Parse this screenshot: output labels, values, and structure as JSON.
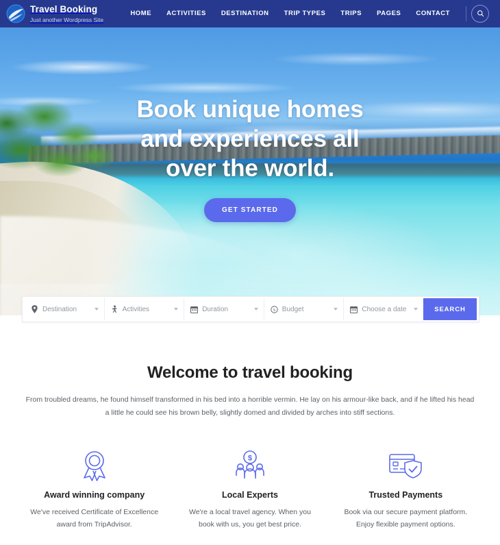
{
  "header": {
    "brand": {
      "title": "Travel Booking",
      "tagline": "Just another Wordpress Site",
      "logo_icon": "swoosh-circle-logo-icon"
    },
    "nav": [
      {
        "label": "HOME"
      },
      {
        "label": "ACTIVITIES"
      },
      {
        "label": "DESTINATION"
      },
      {
        "label": "TRIP TYPES"
      },
      {
        "label": "TRIPS"
      },
      {
        "label": "PAGES"
      },
      {
        "label": "CONTACT"
      }
    ],
    "search_icon": "search-icon",
    "colors": {
      "background": "#25398e",
      "text": "#ffffff"
    }
  },
  "hero": {
    "title": "Book unique homes and experiences all over the world.",
    "cta_label": "GET STARTED",
    "cta_color": "#5b6aec"
  },
  "search_bar": {
    "fields": [
      {
        "placeholder": "Destination",
        "icon": "map-pin-icon"
      },
      {
        "placeholder": "Activities",
        "icon": "hiker-icon"
      },
      {
        "placeholder": "Duration",
        "icon": "calendar-icon"
      },
      {
        "placeholder": "Budget",
        "icon": "dollar-circle-icon"
      },
      {
        "placeholder": "Choose a date",
        "icon": "calendar-icon"
      }
    ],
    "submit_label": "SEARCH",
    "submit_color": "#5b6aec"
  },
  "welcome": {
    "heading": "Welcome to travel booking",
    "body": "From troubled dreams, he found himself transformed in his bed into a horrible vermin. He lay on his armour-like back, and if he lifted his head a little he could see his brown belly, slightly domed and divided by arches into stiff sections."
  },
  "features": [
    {
      "icon": "award-ribbon-icon",
      "title": "Award winning company",
      "body": "We've received Certificate of Excellence award from TripAdvisor."
    },
    {
      "icon": "people-dollar-icon",
      "title": "Local Experts",
      "body": "We're a local travel agency. When you book with us, you get best price."
    },
    {
      "icon": "credit-card-shield-icon",
      "title": "Trusted Payments",
      "body": "Book via our secure payment platform. Enjoy flexible payment options."
    }
  ],
  "accent_color": "#5b6aec"
}
